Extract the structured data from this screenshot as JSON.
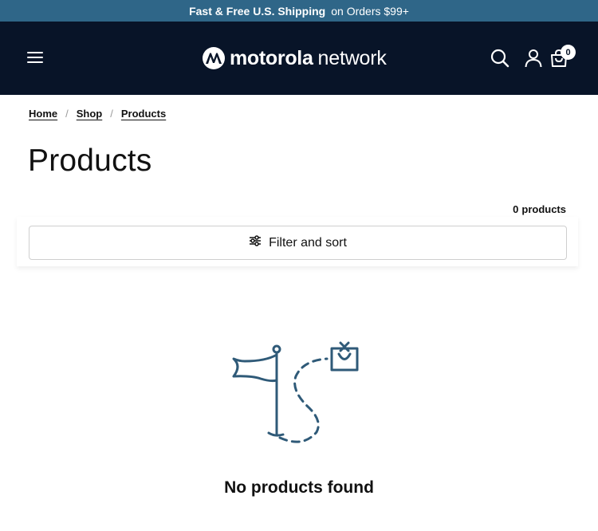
{
  "announcement": {
    "bold": "Fast & Free U.S. Shipping",
    "rest": "on Orders $99+"
  },
  "header": {
    "logo_brand": "motorola",
    "logo_sub": "network",
    "cart_count": "0",
    "icons": [
      "menu-icon",
      "search-icon",
      "account-icon",
      "cart-icon"
    ],
    "background_color": "#081428"
  },
  "breadcrumb": {
    "items": [
      "Home",
      "Shop",
      "Products"
    ],
    "separator": "/"
  },
  "page": {
    "title": "Products",
    "product_count": "0",
    "product_count_unit": "products",
    "filter_label": "Filter and sort",
    "empty_message": "No products found"
  },
  "colors": {
    "announcement_bar": "#2f6688",
    "illustration": "#2f5a78"
  }
}
